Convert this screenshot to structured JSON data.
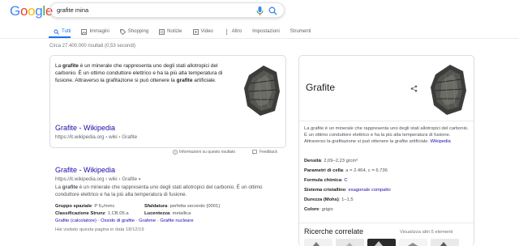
{
  "logo": {
    "letters": [
      "G",
      "o",
      "o",
      "g",
      "l",
      "e"
    ],
    "colors": [
      "#4285f4",
      "#ea4335",
      "#fbbc05",
      "#4285f4",
      "#34a853",
      "#ea4335"
    ]
  },
  "search": {
    "query": "grafite mina"
  },
  "tabs": [
    {
      "label": "Tutti",
      "icon": "search-icon",
      "active": true
    },
    {
      "label": "Immagini",
      "icon": "image-icon"
    },
    {
      "label": "Shopping",
      "icon": "tag-icon"
    },
    {
      "label": "Notizie",
      "icon": "news-icon"
    },
    {
      "label": "Video",
      "icon": "video-icon"
    },
    {
      "label": "Altro",
      "icon": "more-icon"
    },
    {
      "label": "Impostazioni"
    },
    {
      "label": "Strumenti"
    }
  ],
  "result_stats": "Circa 27.400.000 risultati (0,53 secondi)",
  "snippet": {
    "text_parts": [
      "La ",
      "grafite",
      " è un minerale che rappresenta uno degli stati allotropici del carbonio. È un ottimo conduttore elettrico e ha la più alta temperatura di fusione. Attraverso la grafitazione si può ottenere la ",
      "grafite",
      " artificiale."
    ],
    "link_title": "Grafite - Wikipedia",
    "url": "https://it.wikipedia.org › wiki › Grafite",
    "info_label": "Informazioni su questo risultato",
    "feedback_label": "Feedback"
  },
  "result2": {
    "title": "Grafite - Wikipedia",
    "url": "https://it.wikipedia.org › wiki › Grafite",
    "desc_parts": [
      "La ",
      "grafite",
      " è un minerale che rappresenta uno degli stati allotropici del carbonio. È un ottimo conduttore elettrico e ha la più alta temperatura di fusione."
    ],
    "facts": [
      [
        {
          "k": "Gruppo spaziale",
          "v": "P 6₃/mmc"
        },
        {
          "k": "Sfaldatura",
          "v": "perfetta secondo {0001}"
        }
      ],
      [
        {
          "k": "Classificazione Strunz",
          "v": "1.CB.05.a"
        },
        {
          "k": "Lucentezza",
          "v": "metallica"
        }
      ]
    ],
    "links": [
      "Grafite (calcolatore)",
      "Ossido di grafite",
      "Grafene",
      "Grafite nucleare"
    ],
    "visited": "Hai visitato questa pagina in data 18/12/19"
  },
  "knowledge_panel": {
    "title": "Grafite",
    "description": "La grafite è un minerale che rappresenta uno degli stati allotropici del carbonio. È un ottimo conduttore elettrico e ha la più alta temperatura di fusione. Attraverso la grafitazione si può ottenere la grafite artificiale.",
    "source_link": "Wikipedia",
    "facts": [
      {
        "k": "Densità",
        "v": "2,09–2,23 g/cm³"
      },
      {
        "k": "Parametri di cella",
        "v": "a = 2.464, c = 6.736"
      },
      {
        "k": "Formula chimica",
        "v": "C",
        "link": true
      },
      {
        "k": "Sistema cristallino",
        "v": "esagonale compatto",
        "link": true
      },
      {
        "k": "Durezza (Mohs)",
        "v": "1–1,5"
      },
      {
        "k": "Colore",
        "v": "grigio"
      }
    ],
    "related_title": "Ricerche correlate",
    "view_more": "Visualizza altri 5 elementi"
  }
}
